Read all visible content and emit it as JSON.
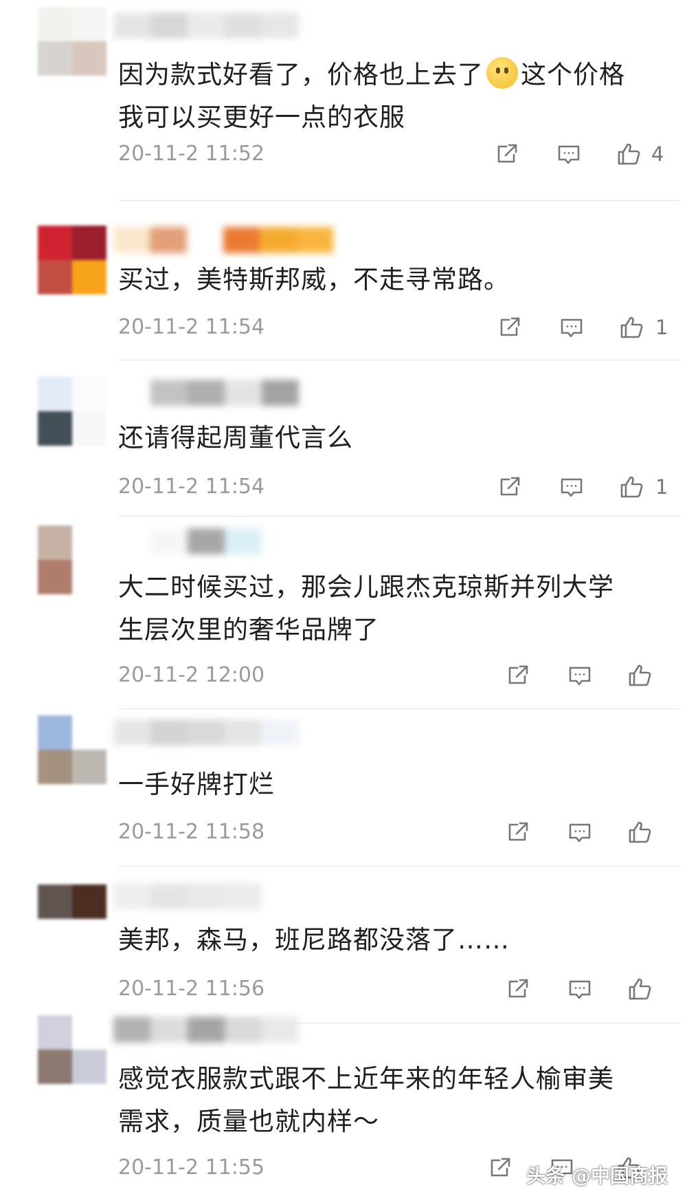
{
  "comments": [
    {
      "avatar_colors": [
        "#f1f2ee",
        "#f5f5f3",
        "#d7d3cf",
        "#d9c7bd"
      ],
      "name_colors": [
        "#e3e3e3",
        "#d3d3d3",
        "#e8e8e8",
        "#dcdcdc",
        "#e4e4e4"
      ],
      "text_before_emoji": "因为款式好看了，价格也上去了",
      "text_after_emoji": "这个价格",
      "text_line2": "我可以买更好一点的衣服",
      "time": "20-11-2 11:52",
      "likes": "4"
    },
    {
      "avatar_colors": [
        "#cf2331",
        "#9c1f2e",
        "#c24f42",
        "#f7a31c"
      ],
      "name_colors": [
        "#fbe5c6",
        "#e0956a",
        "#ffffff",
        "#e96c1e",
        "#f4a21a",
        "#f9ae2a"
      ],
      "text": "买过，美特斯邦威，不走寻常路。",
      "time": "20-11-2 11:54",
      "likes": "1"
    },
    {
      "avatar_colors": [
        "#e3eaf8",
        "#fbfbfd",
        "#435057",
        "#f6f7f8"
      ],
      "name_colors": [
        "#ffffff",
        "#bcbcbc",
        "#a7a7a7",
        "#e1e1e1",
        "#9a9a9a"
      ],
      "text": "还请得起周董代言么",
      "time": "20-11-2 11:54",
      "likes": "1"
    },
    {
      "avatar_colors": [
        "#c5b2a4",
        "#ffffff",
        "#af7c6e",
        "#ffffff"
      ],
      "name_colors": [
        "#ffffff",
        "#f6f6f6",
        "#9e9e9e",
        "#d7eef6",
        "#ffffff"
      ],
      "text": "大二时候买过，那会儿跟杰克琼斯并列大学",
      "text_line2": "生层次里的奢华品牌了",
      "time": "20-11-2 12:00",
      "likes": ""
    },
    {
      "avatar_colors": [
        "#9db7de",
        "#ffffff",
        "#a59180",
        "#bcb7b0"
      ],
      "name_colors": [
        "#e4e4e4",
        "#cfcfcf",
        "#d6d6d6",
        "#e2e2e2",
        "#eef2f8"
      ],
      "text": "一手好牌打烂",
      "time": "20-11-2 11:58",
      "likes": ""
    },
    {
      "avatar_colors": [
        "#615552",
        "#4b2d22"
      ],
      "name_colors": [
        "#ececec",
        "#e2e2e2",
        "#e7e7e7",
        "#eaeaea"
      ],
      "text": "美邦，森马，班尼路都没落了……",
      "time": "20-11-2 11:56",
      "likes": ""
    },
    {
      "avatar_colors": [
        "#d2d0de",
        "#ffffff",
        "#8b7870",
        "#c9ccd8"
      ],
      "name_colors": [
        "#aaaaaa",
        "#d9d9d9",
        "#9c9c9c",
        "#d6d6d6",
        "#e7e7e7"
      ],
      "text": "感觉衣服款式跟不上近年来的年轻人榆审美",
      "text_line2": "需求，质量也就内样～",
      "time": "20-11-2 11:55",
      "likes": ""
    }
  ],
  "icons": {
    "share": "share-icon",
    "comment": "comment-icon",
    "like": "thumbs-up-icon"
  },
  "watermark": "头条 @中国商报"
}
